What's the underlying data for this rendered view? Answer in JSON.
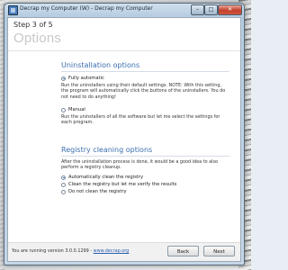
{
  "window": {
    "title": "Decrap my Computer (W) - Decrap my Computer",
    "controls": {
      "minimize": "–",
      "maximize": "□",
      "close": "✕"
    }
  },
  "header": {
    "step": "Step 3 of 5",
    "title": "Options"
  },
  "uninstallation": {
    "title": "Uninstallation options",
    "options": [
      {
        "label": "Fully automatic",
        "selected": true,
        "description": "Run the uninstallers using their default settings. NOTE: With this setting, the program will automatically click the buttons of the uninstallers. You do not need to do anything!"
      },
      {
        "label": "Manual",
        "selected": false,
        "description": "Run the uninstallers of all the software but let me select the settings for each program."
      }
    ]
  },
  "registry": {
    "title": "Registry cleaning options",
    "description": "After the uninstallation process is done, it would be a good idea to also perform a registry cleanup.",
    "options": [
      {
        "label": "Automatically clean the registry",
        "selected": true
      },
      {
        "label": "Clean the registry but let me verify the results",
        "selected": false
      },
      {
        "label": "Do not clean the registry",
        "selected": false
      }
    ]
  },
  "footer": {
    "version_text": "You are running version 3.0.0.1299 -",
    "link": "www.decrap.org",
    "back_label": "Back",
    "next_label": "Next"
  },
  "colors": {
    "accent": "#3b6fb0",
    "title_gray": "#c8c8c8",
    "close": "#c2402b"
  },
  "icons": {
    "app": "app-icon",
    "radio": "radio-icon"
  }
}
